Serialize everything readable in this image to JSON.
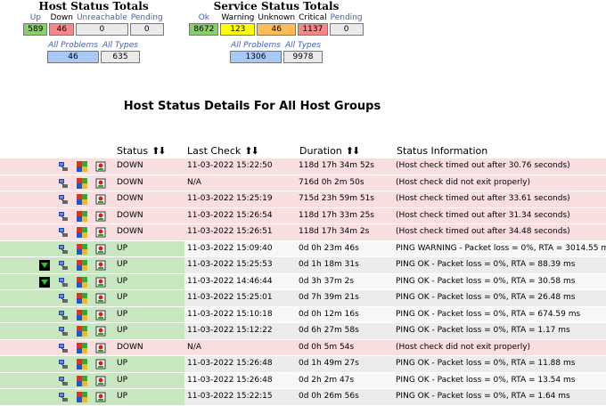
{
  "host_totals": {
    "title": "Host Status Totals",
    "headers": [
      "Up",
      "Down",
      "Unreachable",
      "Pending"
    ],
    "values": [
      "589",
      "46",
      "0",
      "0"
    ],
    "sub_headers": [
      "All Problems",
      "All Types"
    ],
    "sub_values": [
      "46",
      "635"
    ]
  },
  "service_totals": {
    "title": "Service Status Totals",
    "headers": [
      "Ok",
      "Warning",
      "Unknown",
      "Critical",
      "Pending"
    ],
    "values": [
      "8672",
      "123",
      "46",
      "1137",
      "0"
    ],
    "sub_headers": [
      "All Problems",
      "All Types"
    ],
    "sub_values": [
      "1306",
      "9978"
    ]
  },
  "page_title": "Host Status Details For All Host Groups",
  "columns": {
    "status": "Status",
    "last_check": "Last Check",
    "duration": "Duration",
    "info": "Status Information",
    "sort_icon": "⬆⬇"
  },
  "rows": [
    {
      "state": "down",
      "flag": false,
      "status": "DOWN",
      "last_check": "11-03-2022 15:22:50",
      "duration": "118d 17h 34m 52s",
      "info": "(Host check timed out after 30.76 seconds)"
    },
    {
      "state": "down",
      "flag": false,
      "status": "DOWN",
      "last_check": "N/A",
      "duration": "716d 0h 2m 50s",
      "info": "(Host check did not exit properly)"
    },
    {
      "state": "down",
      "flag": false,
      "status": "DOWN",
      "last_check": "11-03-2022 15:25:19",
      "duration": "715d 23h 59m 51s",
      "info": "(Host check timed out after 33.61 seconds)"
    },
    {
      "state": "down",
      "flag": false,
      "status": "DOWN",
      "last_check": "11-03-2022 15:26:54",
      "duration": "118d 17h 33m 25s",
      "info": "(Host check timed out after 31.34 seconds)"
    },
    {
      "state": "down",
      "flag": false,
      "status": "DOWN",
      "last_check": "11-03-2022 15:26:51",
      "duration": "118d 17h 34m 2s",
      "info": "(Host check timed out after 34.48 seconds)"
    },
    {
      "state": "up",
      "flag": false,
      "status": "UP",
      "last_check": "11-03-2022 15:09:40",
      "duration": "0d 0h 23m 46s",
      "info": "PING WARNING - Packet loss = 0%, RTA = 3014.55 ms"
    },
    {
      "state": "up",
      "flag": true,
      "status": "UP",
      "last_check": "11-03-2022 15:25:53",
      "duration": "0d 1h 18m 31s",
      "info": "PING OK - Packet loss = 0%, RTA = 88.39 ms"
    },
    {
      "state": "up",
      "flag": true,
      "status": "UP",
      "last_check": "11-03-2022 14:46:44",
      "duration": "0d 3h 37m 2s",
      "info": "PING OK - Packet loss = 0%, RTA = 30.58 ms"
    },
    {
      "state": "up",
      "flag": false,
      "status": "UP",
      "last_check": "11-03-2022 15:25:01",
      "duration": "0d 7h 39m 21s",
      "info": "PING OK - Packet loss = 0%, RTA = 26.48 ms"
    },
    {
      "state": "up",
      "flag": false,
      "status": "UP",
      "last_check": "11-03-2022 15:10:18",
      "duration": "0d 0h 12m 16s",
      "info": "PING OK - Packet loss = 0%, RTA = 674.59 ms"
    },
    {
      "state": "up",
      "flag": false,
      "status": "UP",
      "last_check": "11-03-2022 15:12:22",
      "duration": "0d 6h 27m 58s",
      "info": "PING OK - Packet loss = 0%, RTA = 1.17 ms"
    },
    {
      "state": "down",
      "flag": false,
      "status": "DOWN",
      "last_check": "N/A",
      "duration": "0d 0h 5m 54s",
      "info": "(Host check did not exit properly)"
    },
    {
      "state": "up",
      "flag": false,
      "status": "UP",
      "last_check": "11-03-2022 15:26:48",
      "duration": "0d 1h 49m 27s",
      "info": "PING OK - Packet loss = 0%, RTA = 11.88 ms"
    },
    {
      "state": "up",
      "flag": false,
      "status": "UP",
      "last_check": "11-03-2022 15:26:48",
      "duration": "0d 2h 2m 47s",
      "info": "PING OK - Packet loss = 0%, RTA = 13.54 ms"
    },
    {
      "state": "up",
      "flag": false,
      "status": "UP",
      "last_check": "11-03-2022 15:22:15",
      "duration": "0d 0h 26m 56s",
      "info": "PING OK - Packet loss = 0%, RTA = 1.64 ms"
    }
  ]
}
